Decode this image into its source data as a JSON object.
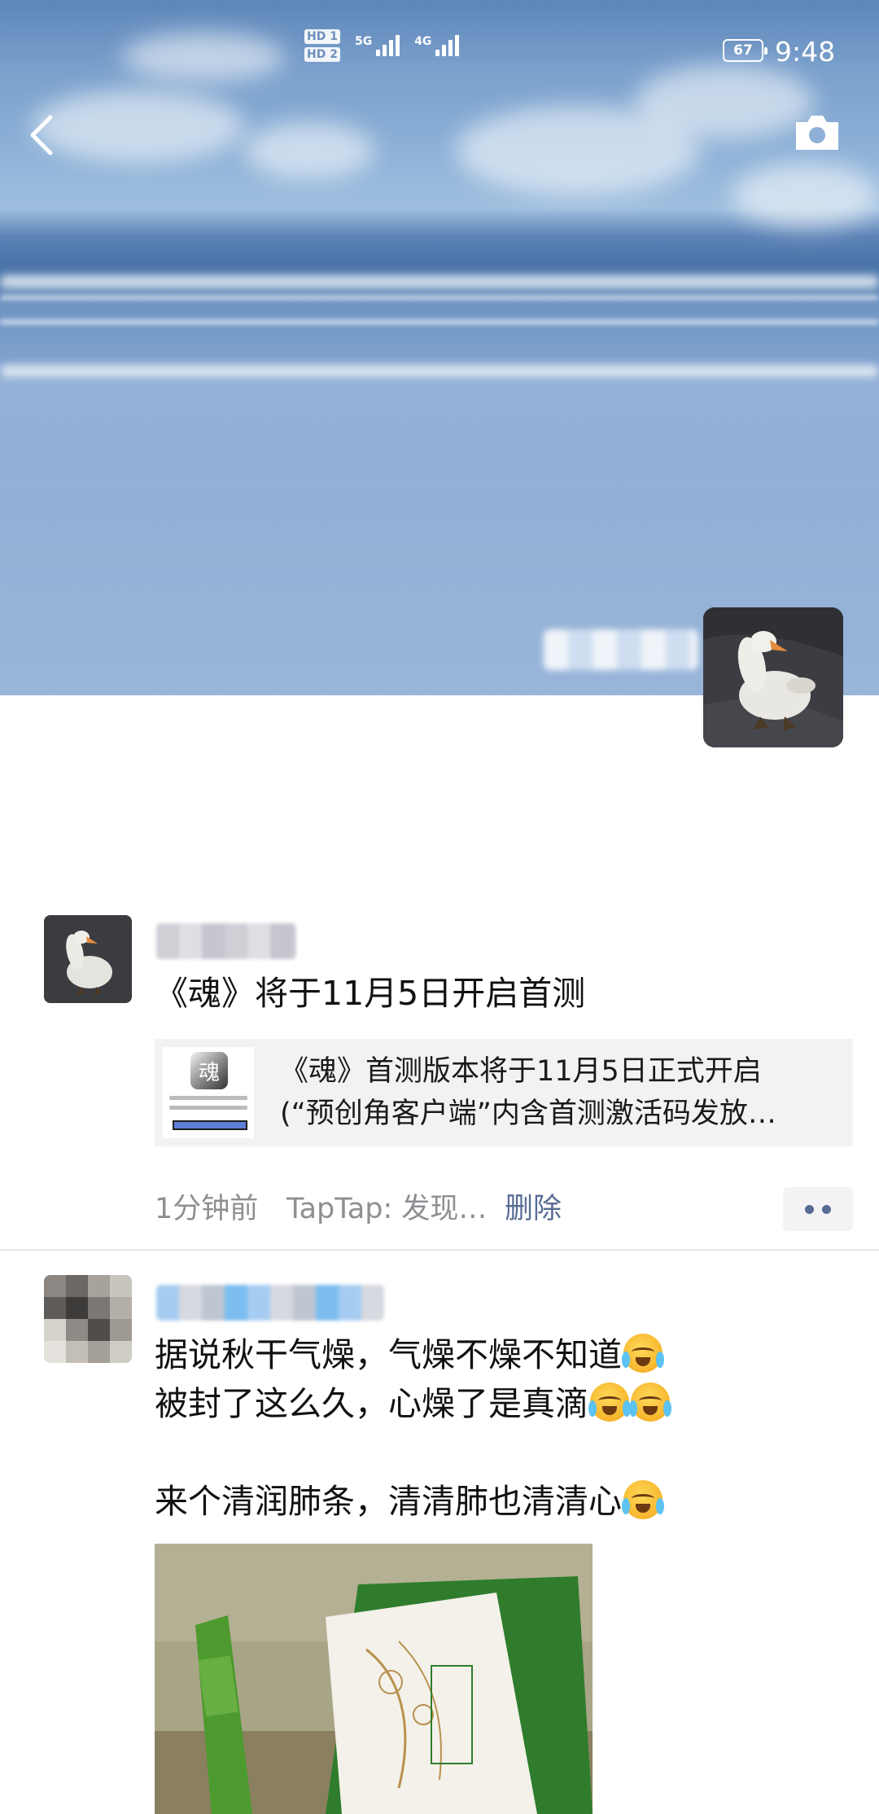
{
  "status_bar": {
    "sim1_tag": "HD 1",
    "sim2_tag": "HD 2",
    "network1": "5G",
    "network2": "4G",
    "battery": "67",
    "time": "9:48"
  },
  "header": {
    "back_icon": "chevron-left-icon",
    "camera_icon": "camera-icon"
  },
  "posts": [
    {
      "text": "《魂》将于11月5日开启首测",
      "link": {
        "title_line1": "《魂》首测版本将于11月5日正式开启",
        "title_line2": "(“预创角客户端”内含首测激活码发放…",
        "thumb_glyph": "魂"
      },
      "time": "1分钟前",
      "source": "TapTap: 发现…",
      "delete_label": "删除"
    },
    {
      "line1": "据说秋干气燥，气燥不燥不知道",
      "line2": "被封了这么久，心燥了是真滴",
      "line3": "来个清润肺条，清清肺也清清心",
      "emoji": "face-with-tears-of-joy-emoji"
    }
  ],
  "colors": {
    "link": "#576b95",
    "meta": "#8e8e93",
    "card_bg": "#f2f2f2"
  }
}
